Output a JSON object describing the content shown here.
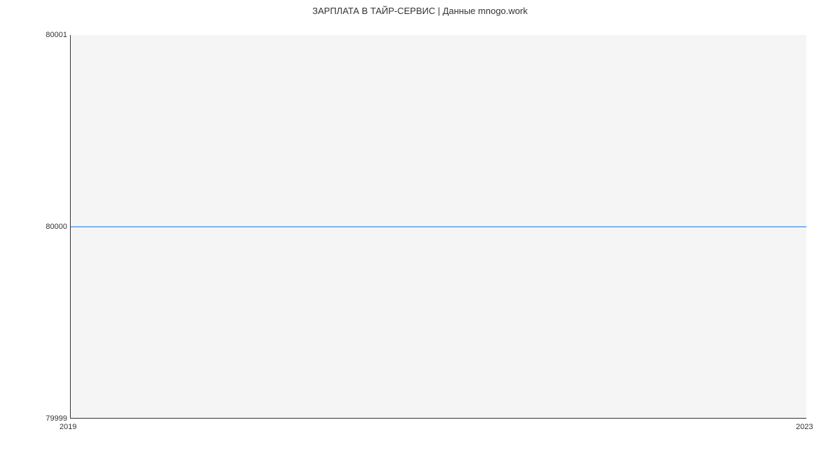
{
  "chart_data": {
    "type": "line",
    "title": "ЗАРПЛАТА В ТАЙР-СЕРВИС | Данные mnogo.work",
    "xlabel": "",
    "ylabel": "",
    "x": [
      2019,
      2023
    ],
    "values": [
      80000,
      80000
    ],
    "xlim": [
      2019,
      2023
    ],
    "ylim": [
      79999,
      80001
    ],
    "x_ticks": [
      "2019",
      "2023"
    ],
    "y_ticks": [
      "79999",
      "80000",
      "80001"
    ],
    "line_color": "#7cb5ec"
  }
}
